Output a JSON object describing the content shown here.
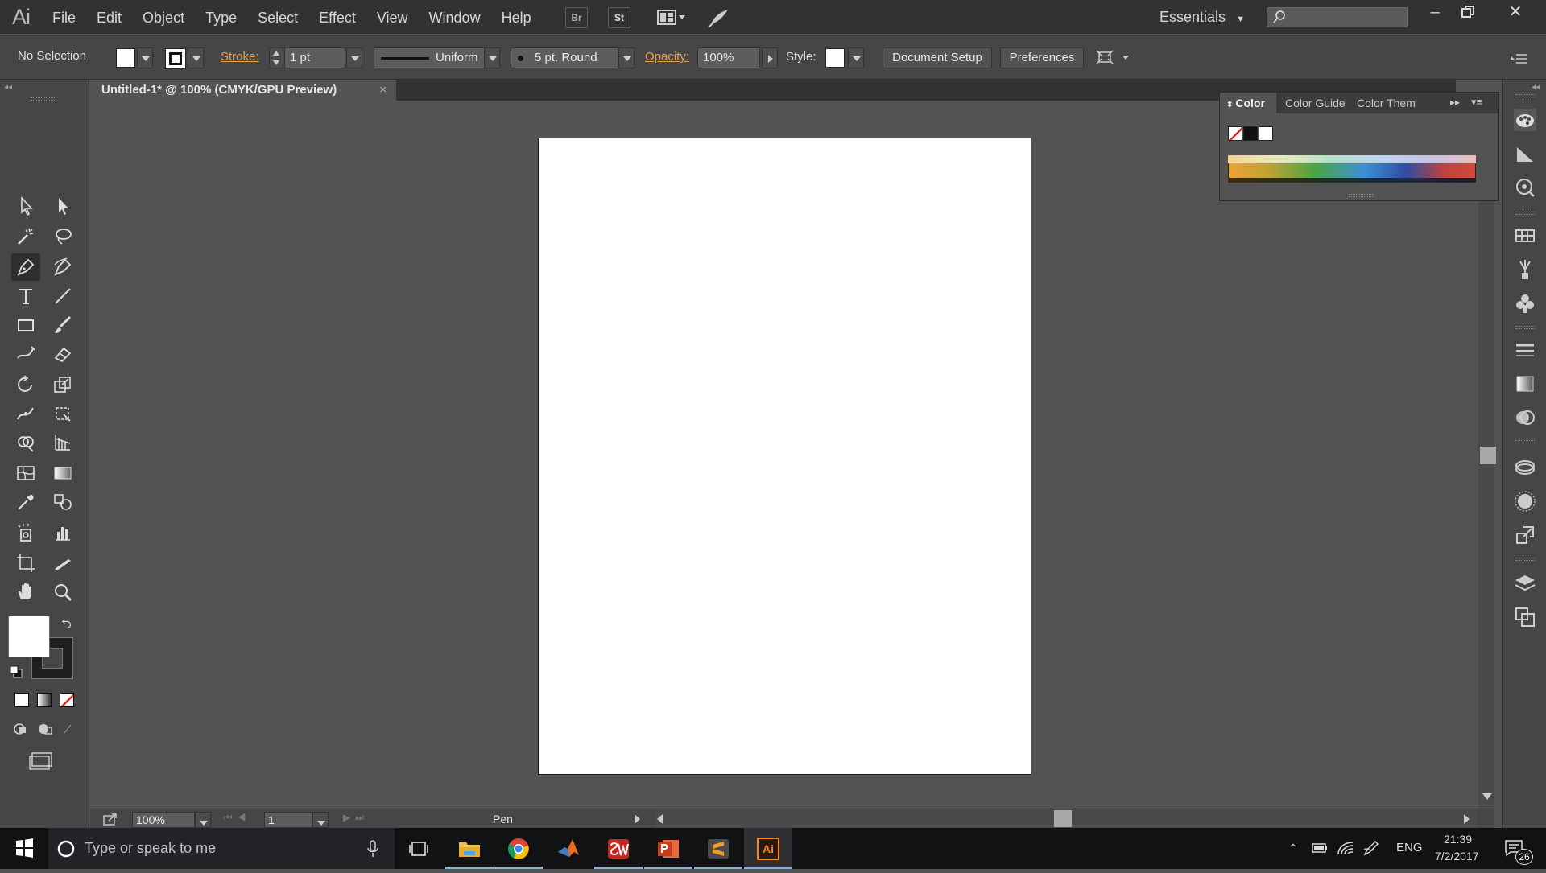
{
  "app": {
    "logo": "Ai"
  },
  "menu": [
    "File",
    "Edit",
    "Object",
    "Type",
    "Select",
    "Effect",
    "View",
    "Window",
    "Help"
  ],
  "menu_icons": {
    "bridge": "Br",
    "stock": "St"
  },
  "workspace": {
    "label": "Essentials",
    "search_placeholder": ""
  },
  "control_bar": {
    "selection": "No Selection",
    "stroke_label": "Stroke:",
    "stroke_weight": "1 pt",
    "profile": "Uniform",
    "brush": "5 pt. Round",
    "opacity_label": "Opacity:",
    "opacity": "100%",
    "style_label": "Style:",
    "document_setup": "Document Setup",
    "preferences": "Preferences"
  },
  "document": {
    "tab_title": "Untitled-1* @ 100% (CMYK/GPU Preview)",
    "close": "×"
  },
  "status_bar": {
    "zoom": "100%",
    "artboard": "1",
    "tool": "Pen"
  },
  "color_panel": {
    "tabs": [
      "Color",
      "Color Guide",
      "Color Them"
    ]
  },
  "taskbar": {
    "search_placeholder": "Type or speak to me",
    "language": "ENG",
    "time": "21:39",
    "date": "7/2/2017",
    "notifications": "26"
  },
  "colors": {
    "accent_orange": "#e6a24c",
    "ui_bg": "#535353",
    "panel_bg": "#464646",
    "menubar": "#323232"
  }
}
